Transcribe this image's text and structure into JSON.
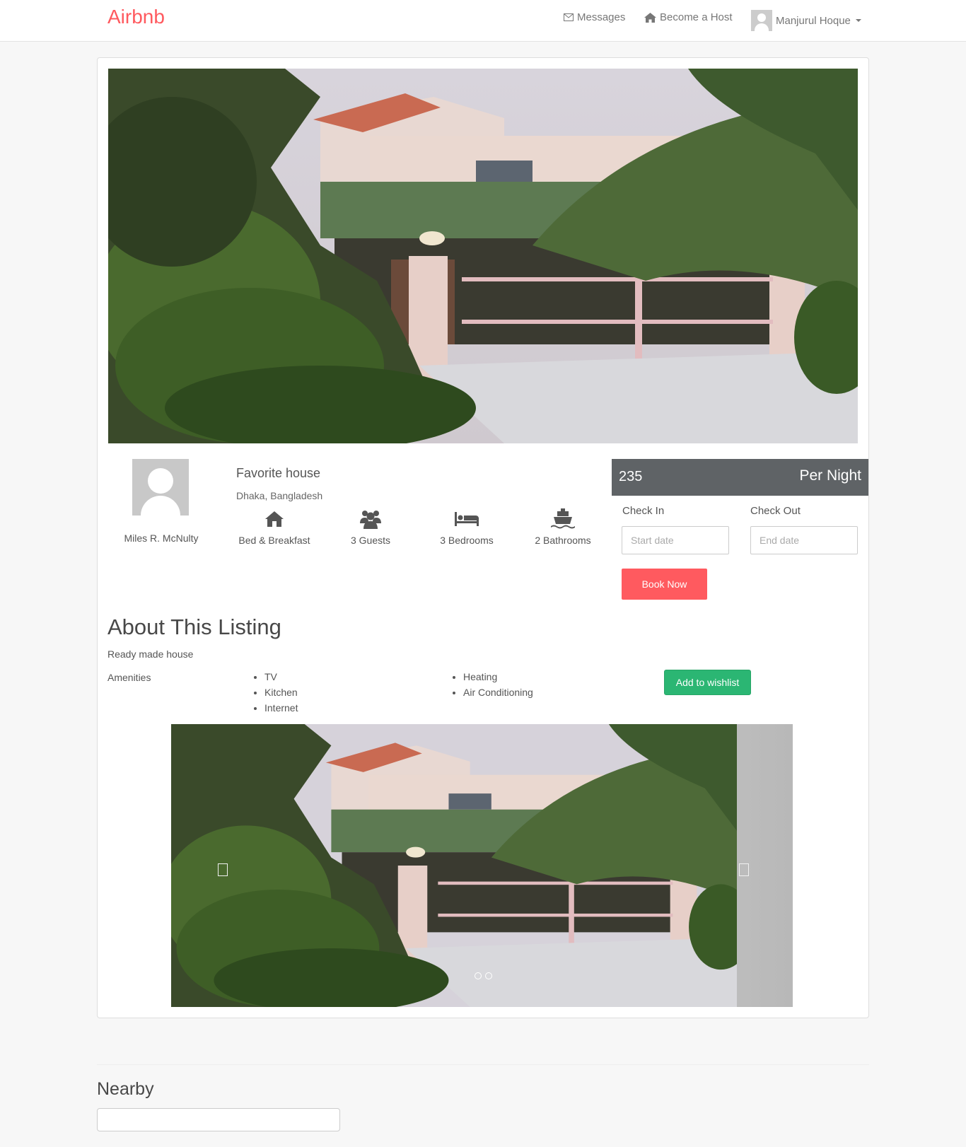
{
  "header": {
    "brand": "Airbnb",
    "messages_label": "Messages",
    "host_label": "Become a Host",
    "user_name": "Manjurul Hoque"
  },
  "host": {
    "name": "Miles R. McNulty"
  },
  "listing": {
    "title": "Favorite house",
    "location": "Dhaka, Bangladesh",
    "features": {
      "type": "Bed & Breakfast",
      "guests": "3 Guests",
      "bedrooms": "3 Bedrooms",
      "bathrooms": "2 Bathrooms"
    }
  },
  "booking": {
    "price": "235",
    "unit": "Per Night",
    "check_in_label": "Check In",
    "check_out_label": "Check Out",
    "start_placeholder": "Start date",
    "end_placeholder": "End date",
    "book_label": "Book Now"
  },
  "about": {
    "heading": "About This Listing",
    "description": "Ready made house",
    "amenities_label": "Amenities",
    "amenities_col1": [
      "TV",
      "Kitchen",
      "Internet"
    ],
    "amenities_col2": [
      "Heating",
      "Air Conditioning"
    ],
    "wishlist_label": "Add to wishlist"
  },
  "nearby": {
    "heading": "Nearby"
  },
  "colors": {
    "brand": "#ff5a5f",
    "price_bar": "#5f6366",
    "wishlist": "#2bb673"
  },
  "icons": [
    "envelope-icon",
    "home-icon",
    "user-avatar",
    "chevron-down-icon",
    "house-icon",
    "users-icon",
    "bed-icon",
    "ship-icon"
  ]
}
